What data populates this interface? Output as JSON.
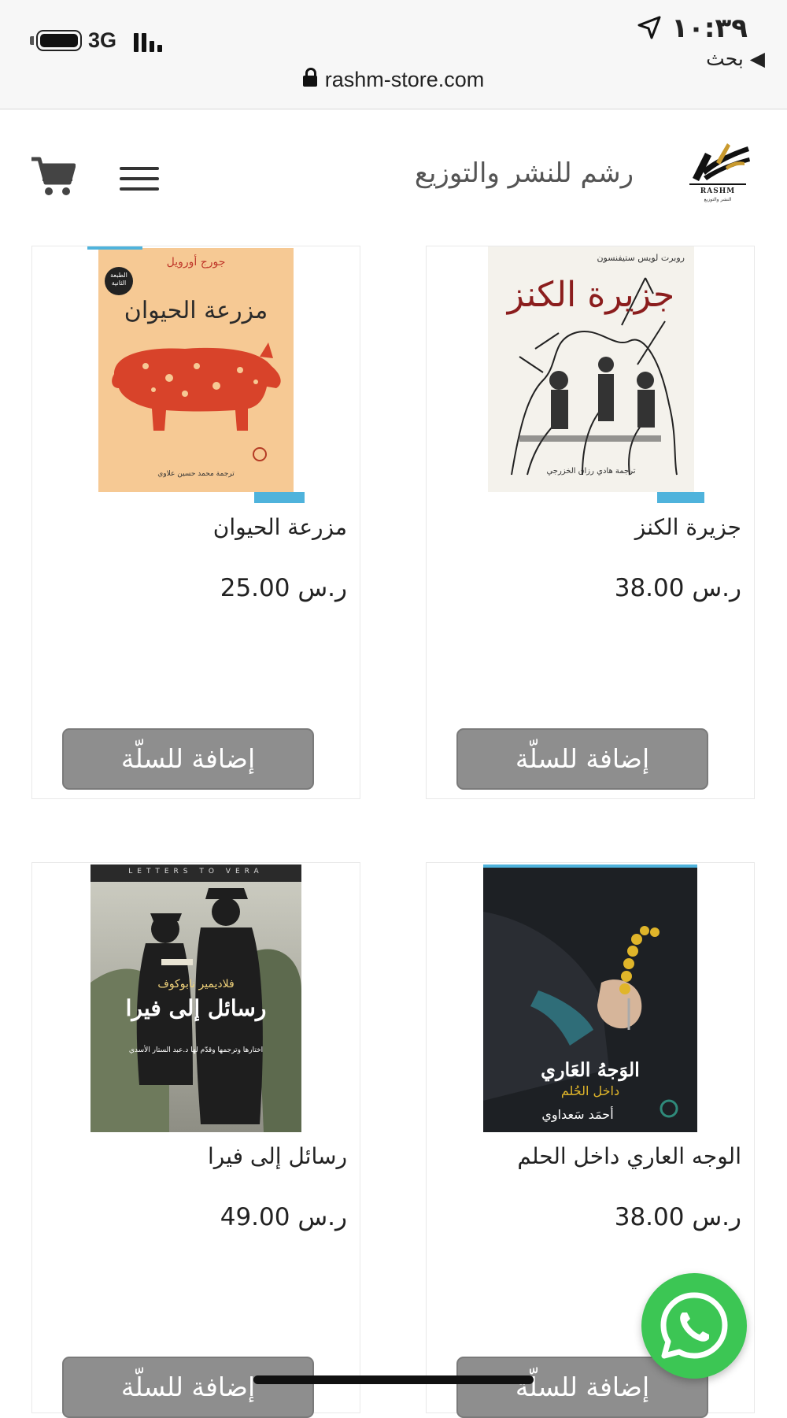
{
  "status_bar": {
    "network": "3G",
    "time": "١٠:٣٩",
    "back_label": "◀ بحث"
  },
  "browser": {
    "url": "rashm-store.com"
  },
  "header": {
    "site_name": "رشم للنشر والتوزيع",
    "logo_text": "RASHM",
    "logo_subtext": "النشر والتوزيع"
  },
  "products": [
    {
      "title": "جزيرة الكنز",
      "price": "ر.س 38.00",
      "button": "إضافة للسلّة",
      "cover_author": "روبرت لويس ستيفنسون",
      "cover_title": "جزيرة الكنز",
      "cover_translator": "ترجمة هادي رزاق الخزرجي"
    },
    {
      "title": "مزرعة الحيوان",
      "price": "ر.س 25.00",
      "button": "إضافة للسلّة",
      "cover_author": "جورج أورويل",
      "cover_title": "مزرعة الحيوان",
      "cover_badge": "الطبعة الثانية",
      "cover_translator": "ترجمة محمد حسين علاوي"
    },
    {
      "title": "الوجه العاري داخل الحلم",
      "price": "ر.س 38.00",
      "button": "إضافة للسلّة",
      "cover_title": "الوَجهُ العَاري",
      "cover_subtitle": "داخل الحُلم",
      "cover_author": "أحمَد سَعداوي"
    },
    {
      "title": "رسائل إلى فيرا",
      "price": "ر.س 49.00",
      "button": "إضافة للسلّة",
      "cover_top": "LETTERS TO VERA",
      "cover_author": "فلاديمير نابوكوف",
      "cover_title": "رسائل إلى فيرا",
      "cover_translator": "اختارها وترجمها وقدّم لها د.عبد الستار الأسدي"
    }
  ],
  "colors": {
    "button_bg": "#8e8e8e",
    "accent_tag": "#4fb3dc",
    "whatsapp": "#3cc654"
  }
}
